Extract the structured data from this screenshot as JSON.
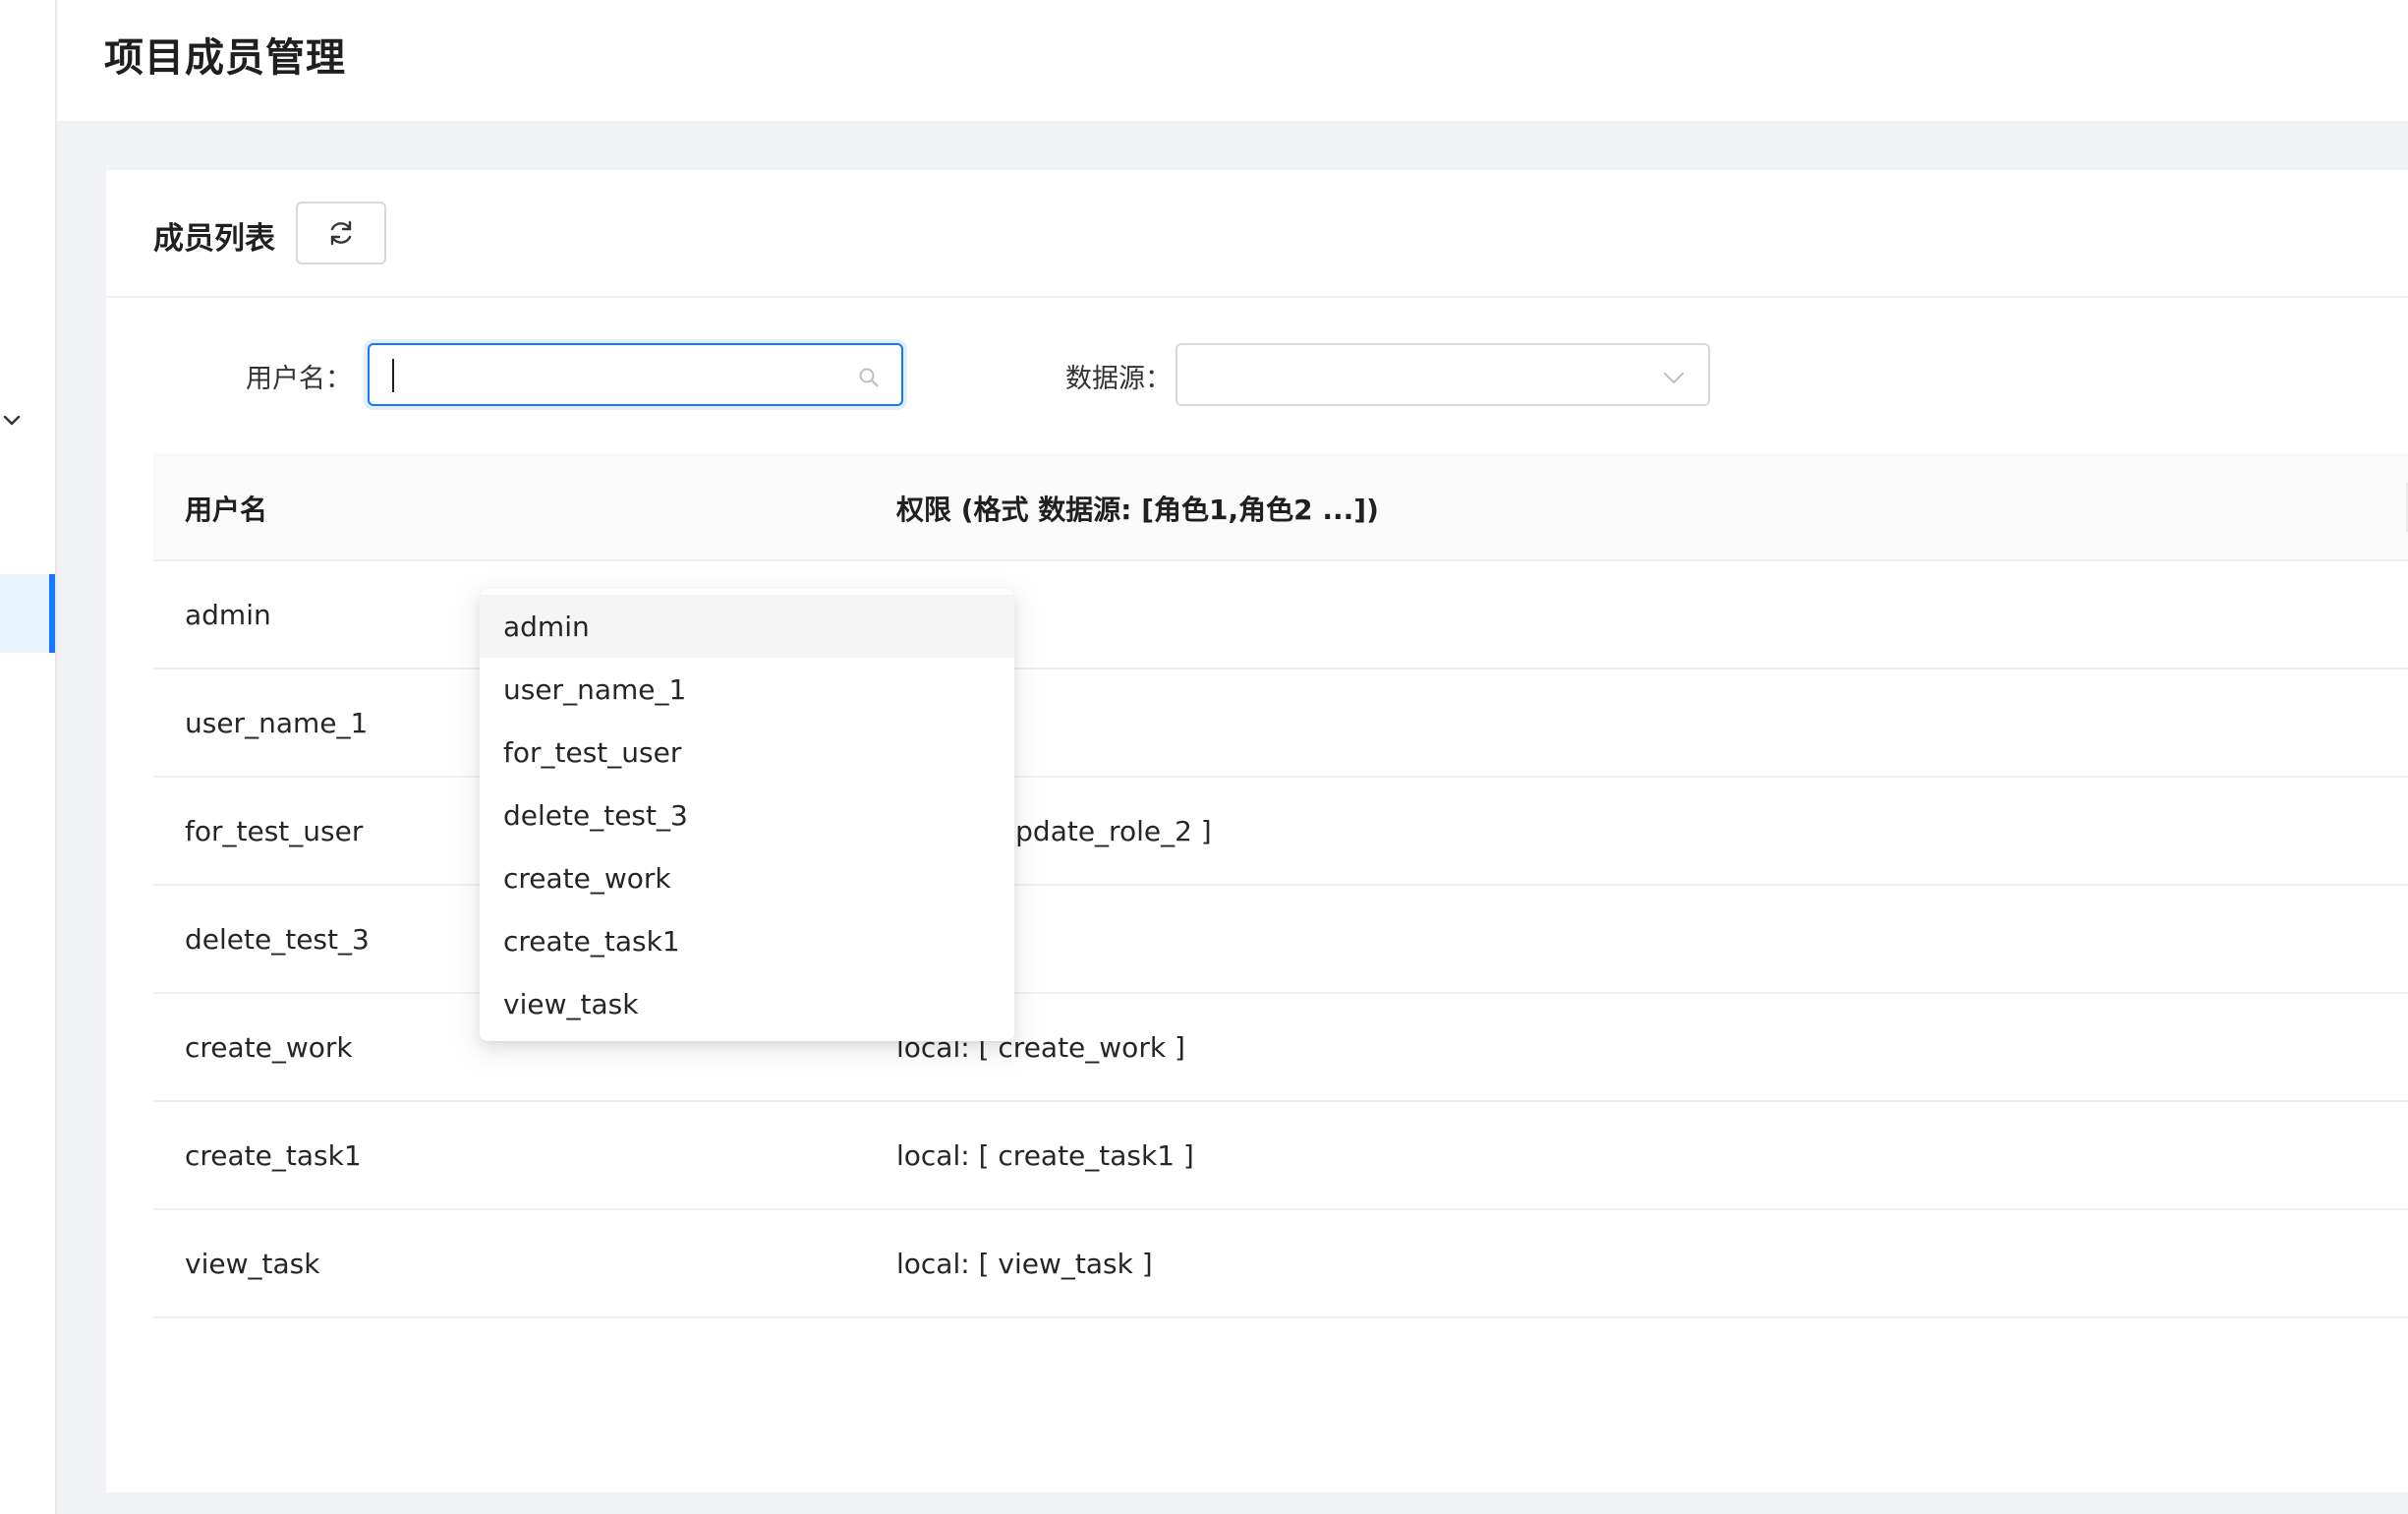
{
  "page": {
    "title": "项目成员管理"
  },
  "card": {
    "title": "成员列表",
    "refresh_icon": "refresh-icon"
  },
  "filters": {
    "username_label": "用户名：",
    "username_value": "",
    "datasource_label": "数据源：",
    "datasource_value": ""
  },
  "table": {
    "columns": [
      "用户名",
      "权限 (格式 数据源: [角色1,角色2 ...])"
    ],
    "rows": [
      {
        "username": "admin",
        "permission": ""
      },
      {
        "username": "user_name_1",
        "permission": ""
      },
      {
        "username": "for_test_user",
        "permission": "local: [ update_role_2 ]"
      },
      {
        "username": "delete_test_3",
        "permission": ""
      },
      {
        "username": "create_work",
        "permission": "local: [ create_work ]"
      },
      {
        "username": "create_task1",
        "permission": "local: [ create_task1 ]"
      },
      {
        "username": "view_task",
        "permission": "local: [ view_task ]"
      }
    ]
  },
  "dropdown": {
    "options": [
      "admin",
      "user_name_1",
      "for_test_user",
      "delete_test_3",
      "create_work",
      "create_task1",
      "view_task"
    ],
    "active_index": 0
  },
  "colors": {
    "primary": "#1677ff",
    "border": "#d9d9d9",
    "background": "#f0f2f5"
  }
}
